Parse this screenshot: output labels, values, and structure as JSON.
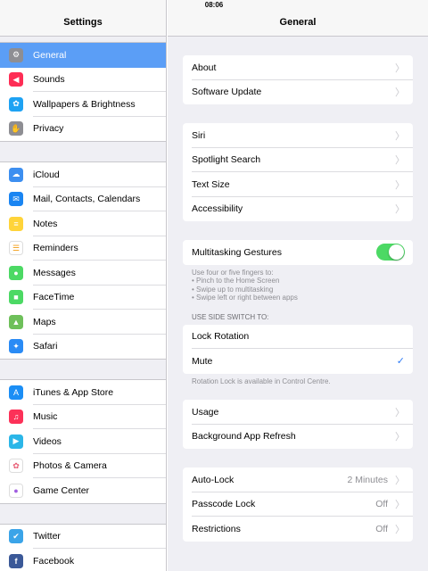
{
  "status": {
    "time": "08:06"
  },
  "master": {
    "title": "Settings",
    "groups": [
      [
        {
          "label": "General",
          "icon": "gear-icon",
          "color": "#8e8e93"
        },
        {
          "label": "Sounds",
          "icon": "speaker-icon",
          "color": "#fe2d55"
        },
        {
          "label": "Wallpapers & Brightness",
          "icon": "flower-icon",
          "color": "#1ea2f3"
        },
        {
          "label": "Privacy",
          "icon": "hand-icon",
          "color": "#8e8e93"
        }
      ],
      [
        {
          "label": "iCloud",
          "icon": "cloud-icon",
          "color": "#3d8ff0"
        },
        {
          "label": "Mail, Contacts, Calendars",
          "icon": "envelope-icon",
          "color": "#1a85f2"
        },
        {
          "label": "Notes",
          "icon": "notes-icon",
          "color": "#ffd43a"
        },
        {
          "label": "Reminders",
          "icon": "list-icon",
          "color": "#e8e8e8"
        },
        {
          "label": "Messages",
          "icon": "speech-bubble-icon",
          "color": "#4cd964"
        },
        {
          "label": "FaceTime",
          "icon": "video-camera-icon",
          "color": "#4cd964"
        },
        {
          "label": "Maps",
          "icon": "map-icon",
          "color": "#6ec05a"
        },
        {
          "label": "Safari",
          "icon": "compass-icon",
          "color": "#2a8bf5"
        }
      ],
      [
        {
          "label": "iTunes & App Store",
          "icon": "app-store-icon",
          "color": "#1b8ef5"
        },
        {
          "label": "Music",
          "icon": "music-note-icon",
          "color": "#fc3158"
        },
        {
          "label": "Videos",
          "icon": "clapperboard-icon",
          "color": "#2bb6e8"
        },
        {
          "label": "Photos & Camera",
          "icon": "photos-icon",
          "color": "#f5f5f5"
        },
        {
          "label": "Game Center",
          "icon": "game-center-icon",
          "color": "#f5f5f5"
        }
      ],
      [
        {
          "label": "Twitter",
          "icon": "twitter-bird-icon",
          "color": "#3ba4e8"
        },
        {
          "label": "Facebook",
          "icon": "facebook-icon",
          "color": "#3b5998"
        }
      ]
    ]
  },
  "detail": {
    "title": "General",
    "group1": [
      "About",
      "Software Update"
    ],
    "group2": [
      "Siri",
      "Spotlight Search",
      "Text Size",
      "Accessibility"
    ],
    "multitasking": {
      "label": "Multitasking Gestures",
      "on": true,
      "note": [
        "Use four or five fingers to:",
        "• Pinch to the Home Screen",
        "• Swipe up to multitasking",
        "• Swipe left or right between apps"
      ]
    },
    "side_switch": {
      "header": "USE SIDE SWITCH TO:",
      "options": [
        "Lock Rotation",
        "Mute"
      ],
      "selected": "Mute",
      "note": "Rotation Lock is available in Control Centre."
    },
    "group4": [
      "Usage",
      "Background App Refresh"
    ],
    "group5": [
      {
        "label": "Auto-Lock",
        "value": "2 Minutes"
      },
      {
        "label": "Passcode Lock",
        "value": "Off"
      },
      {
        "label": "Restrictions",
        "value": "Off"
      }
    ]
  }
}
